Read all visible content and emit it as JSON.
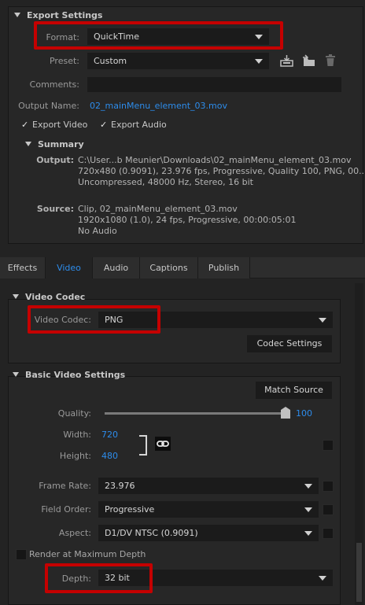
{
  "export_settings": {
    "header": "Export Settings",
    "format_label": "Format:",
    "format_value": "QuickTime",
    "preset_label": "Preset:",
    "preset_value": "Custom",
    "comments_label": "Comments:",
    "output_name_label": "Output Name:",
    "output_name_value": "02_mainMenu_element_03.mov",
    "export_video_label": "Export Video",
    "export_audio_label": "Export Audio",
    "export_video_checked": true,
    "export_audio_checked": true
  },
  "summary": {
    "header": "Summary",
    "output_label": "Output:",
    "output_lines": [
      "C:\\User...b Meunier\\Downloads\\02_mainMenu_element_03.mov",
      "720x480 (0.9091), 23.976 fps, Progressive, Quality 100, PNG, 00...",
      "Uncompressed, 48000 Hz, Stereo, 16 bit"
    ],
    "source_label": "Source:",
    "source_lines": [
      "Clip, 02_mainMenu_element_03.mov",
      "1920x1080 (1.0), 24 fps, Progressive, 00:00:05:01",
      "No Audio"
    ]
  },
  "tabs": [
    "Effects",
    "Video",
    "Audio",
    "Captions",
    "Publish"
  ],
  "active_tab": "Video",
  "video_codec": {
    "header": "Video Codec",
    "codec_label": "Video Codec:",
    "codec_value": "PNG",
    "codec_settings_button": "Codec Settings"
  },
  "basic_video": {
    "header": "Basic Video Settings",
    "match_source_button": "Match Source",
    "quality_label": "Quality:",
    "quality_value": "100",
    "quality_fraction": 1.0,
    "width_label": "Width:",
    "width_value": "720",
    "height_label": "Height:",
    "height_value": "480",
    "frame_rate_label": "Frame Rate:",
    "frame_rate_value": "23.976",
    "field_order_label": "Field Order:",
    "field_order_value": "Progressive",
    "aspect_label": "Aspect:",
    "aspect_value": "D1/DV NTSC (0.9091)",
    "render_max_depth_label": "Render at Maximum Depth",
    "depth_label": "Depth:",
    "depth_value": "32 bit"
  },
  "colors": {
    "accent": "#2d8ceb",
    "highlight": "#c50000",
    "background": "#232323",
    "field": "#1b1b1b"
  },
  "icons": [
    "save-preset-icon",
    "import-preset-icon",
    "delete-preset-icon",
    "link-icon",
    "checkmark-icon",
    "disclosure-triangle-icon",
    "dropdown-arrow-icon"
  ]
}
